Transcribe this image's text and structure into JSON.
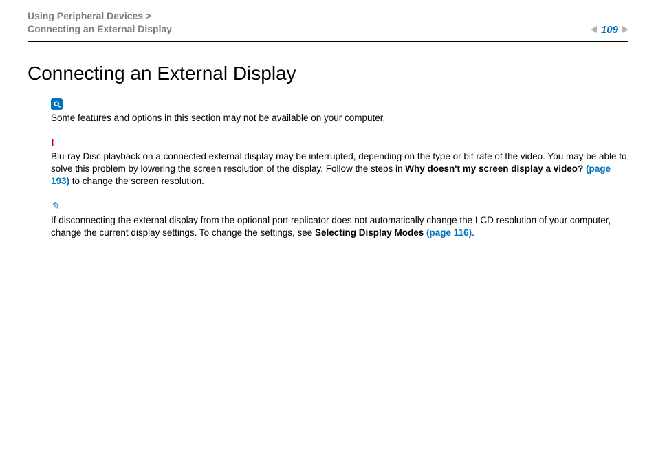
{
  "breadcrumb": {
    "line1": "Using Peripheral Devices >",
    "line2": "Connecting an External Display"
  },
  "page_number": "109",
  "title": "Connecting an External Display",
  "notes": {
    "info": {
      "text": "Some features and options in this section may not be available on your computer."
    },
    "warning": {
      "pre": "Blu-ray Disc playback on a connected external display may be interrupted, depending on the type or bit rate of the video. You may be able to solve this problem by lowering the screen resolution of the display. Follow the steps in ",
      "bold": "Why doesn't my screen display a video? ",
      "link": "(page 193)",
      "post": " to change the screen resolution."
    },
    "tip": {
      "pre": "If disconnecting the external display from the optional port replicator does not automatically change the LCD resolution of your computer, change the current display settings. To change the settings, see ",
      "bold": "Selecting Display Modes ",
      "link": "(page 116)",
      "post": "."
    }
  }
}
